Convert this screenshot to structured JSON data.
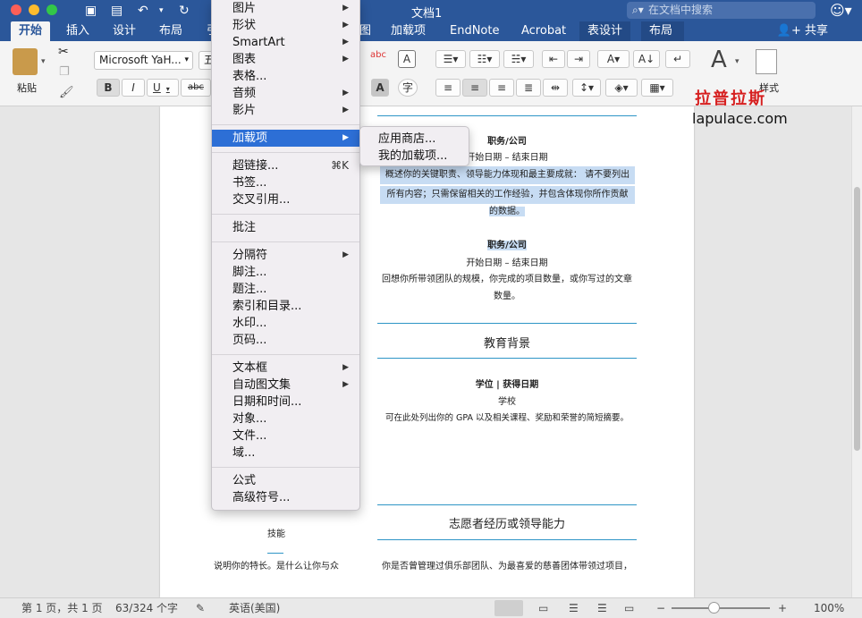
{
  "window": {
    "title": "文档1"
  },
  "search": {
    "placeholder": "在文档中搜索"
  },
  "tabs": [
    "开始",
    "插入",
    "设计",
    "布局",
    "引",
    "图",
    "加载项",
    "EndNote",
    "Acrobat",
    "表设计",
    "布局"
  ],
  "share_label": "共享",
  "ribbon": {
    "paste_label": "粘贴",
    "font_name": "Microsoft YaH...",
    "font_size_partial": "五",
    "bold": "B",
    "italic": "I",
    "underline": "U",
    "strike": "abc",
    "styles_label": "样式",
    "styles_pane_label": "样式",
    "char_shade": "A",
    "phonetic": "字"
  },
  "menu": {
    "items": [
      {
        "label": "图片",
        "submenu": true
      },
      {
        "label": "形状",
        "submenu": true
      },
      {
        "label": "SmartArt",
        "submenu": true
      },
      {
        "label": "图表",
        "submenu": true
      },
      {
        "label": "表格...",
        "submenu": false
      },
      {
        "label": "音频",
        "submenu": true
      },
      {
        "label": "影片",
        "submenu": true
      },
      {
        "label": "加载项",
        "submenu": true,
        "selected": true
      },
      {
        "label": "超链接...",
        "shortcut": "⌘K"
      },
      {
        "label": "书签..."
      },
      {
        "label": "交叉引用..."
      },
      {
        "label": "批注"
      },
      {
        "label": "分隔符",
        "submenu": true
      },
      {
        "label": "脚注..."
      },
      {
        "label": "题注..."
      },
      {
        "label": "索引和目录..."
      },
      {
        "label": "水印..."
      },
      {
        "label": "页码..."
      },
      {
        "label": "文本框",
        "submenu": true
      },
      {
        "label": "自动图文集",
        "submenu": true
      },
      {
        "label": "日期和时间..."
      },
      {
        "label": "对象..."
      },
      {
        "label": "文件..."
      },
      {
        "label": "域..."
      },
      {
        "label": "公式"
      },
      {
        "label": "高级符号..."
      }
    ]
  },
  "submenu": {
    "items": [
      "应用商店...",
      "我的加载项..."
    ]
  },
  "doc": {
    "job_title_1": "职务/公司",
    "dates_1": "开始日期 – 结束日期",
    "desc_1_line1": "概述你的关键职责、领导能力体现和最主要成就： 请不要列出",
    "desc_1_line2": "所有内容；只需保留相关的工作经验，并包含体现你所作贡献",
    "desc_1_line3": "的数据。",
    "job_title_2": "职务/公司",
    "dates_2": "开始日期 – 结束日期",
    "desc_2_line1": "回想你所带领团队的规模，你完成的项目数量，或你写过的文章",
    "desc_2_line2": "数量。",
    "education_heading": "教育背景",
    "degree": "学位 | 获得日期",
    "school": "学校",
    "edu_desc": "可在此处列出你的 GPA 以及相关课程、奖励和荣誉的简短摘要。",
    "volunteer_heading": "志愿者经历或领导能力",
    "volunteer_line1": "你是否曾管理过俱乐部团队、为最喜爱的慈善团体带领过项目，",
    "skills_heading": "技能",
    "skills_line1": "说明你的特长。是什么让你与众"
  },
  "watermark": {
    "cn": "拉普拉斯",
    "en": "lapulace.com"
  },
  "status": {
    "page": "第 1 页，共 1 页",
    "words": "63/324 个字",
    "lang": "英语(美国)",
    "zoom": "100%"
  },
  "colors": {
    "brand": "#2b579a",
    "accent_line": "#2e95c6",
    "menu_selected": "#2d6fd6",
    "watermark": "#d61f1f"
  }
}
